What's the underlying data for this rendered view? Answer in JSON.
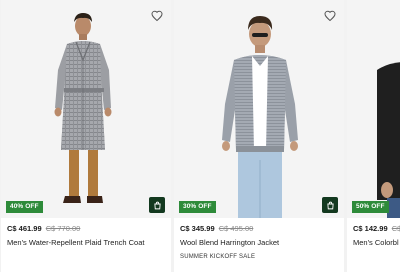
{
  "products": [
    {
      "discount_badge": "40% OFF",
      "price_now": "C$ 461.99",
      "price_was": "C$ 770.00",
      "name": "Men's Water-Repellent Plaid Trench Coat",
      "promo": ""
    },
    {
      "discount_badge": "30% OFF",
      "price_now": "C$ 345.99",
      "price_was": "C$ 495.00",
      "name": "Wool Blend Harrington Jacket",
      "promo": "SUMMER KICKOFF SALE"
    },
    {
      "discount_badge": "50% OFF",
      "price_now": "C$ 142.99",
      "price_was": "C$",
      "name": "Men's Colorbl",
      "promo": ""
    }
  ],
  "icons": {
    "favorite": "heart-outline-icon",
    "add_to_bag": "shopping-bag-icon"
  },
  "colors": {
    "badge": "#2e8b3a",
    "bag_button": "#13391f"
  }
}
